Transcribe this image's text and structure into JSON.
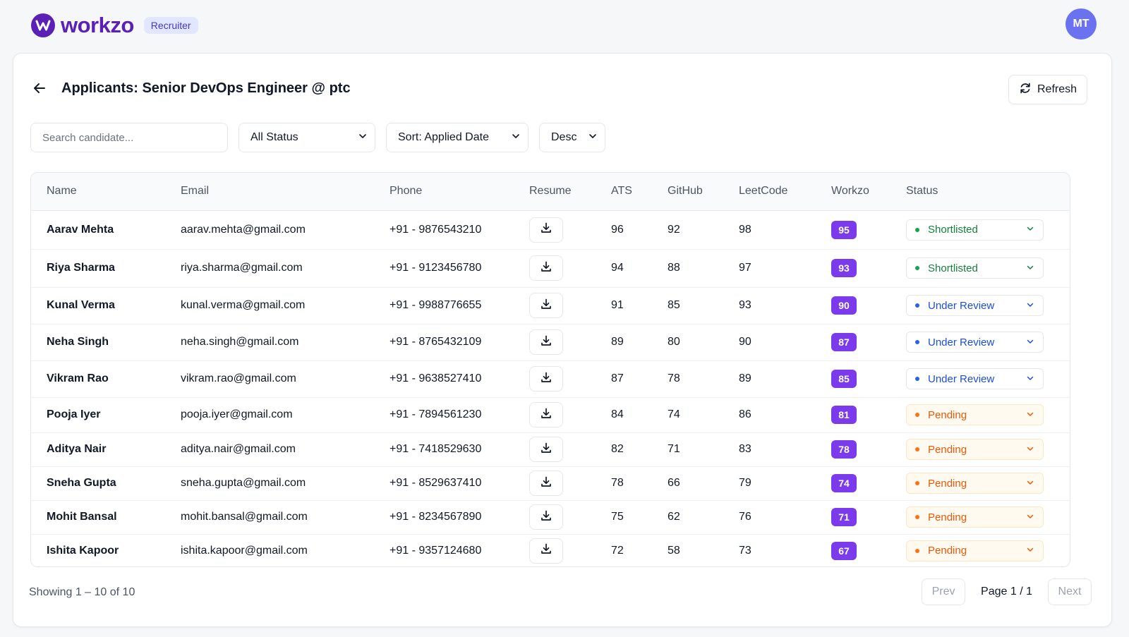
{
  "brand": {
    "name": "workzo",
    "role_badge": "Recruiter",
    "avatar_initials": "MT"
  },
  "header": {
    "title": "Applicants: Senior DevOps Engineer @ ptc",
    "refresh_label": "Refresh"
  },
  "filters": {
    "search_placeholder": "Search candidate...",
    "status_value": "All Status",
    "sort_value": "Sort: Applied Date",
    "order_value": "Desc"
  },
  "table": {
    "columns": [
      "Name",
      "Email",
      "Phone",
      "Resume",
      "ATS",
      "GitHub",
      "LeetCode",
      "Workzo",
      "Status"
    ],
    "rows": [
      {
        "name": "Aarav Mehta",
        "email": "aarav.mehta@gmail.com",
        "phone": "+91 - 9876543210",
        "ats": "96",
        "github": "92",
        "leetcode": "98",
        "workzo": "95",
        "status": "Shortlisted",
        "status_kind": "shortlisted"
      },
      {
        "name": "Riya Sharma",
        "email": "riya.sharma@gmail.com",
        "phone": "+91 - 9123456780",
        "ats": "94",
        "github": "88",
        "leetcode": "97",
        "workzo": "93",
        "status": "Shortlisted",
        "status_kind": "shortlisted"
      },
      {
        "name": "Kunal Verma",
        "email": "kunal.verma@gmail.com",
        "phone": "+91 - 9988776655",
        "ats": "91",
        "github": "85",
        "leetcode": "93",
        "workzo": "90",
        "status": "Under Review",
        "status_kind": "review"
      },
      {
        "name": "Neha Singh",
        "email": "neha.singh@gmail.com",
        "phone": "+91 - 8765432109",
        "ats": "89",
        "github": "80",
        "leetcode": "90",
        "workzo": "87",
        "status": "Under Review",
        "status_kind": "review"
      },
      {
        "name": "Vikram Rao",
        "email": "vikram.rao@gmail.com",
        "phone": "+91 - 9638527410",
        "ats": "87",
        "github": "78",
        "leetcode": "89",
        "workzo": "85",
        "status": "Under Review",
        "status_kind": "review"
      },
      {
        "name": "Pooja Iyer",
        "email": "pooja.iyer@gmail.com",
        "phone": "+91 - 7894561230",
        "ats": "84",
        "github": "74",
        "leetcode": "86",
        "workzo": "81",
        "status": "Pending",
        "status_kind": "pending"
      },
      {
        "name": "Aditya Nair",
        "email": "aditya.nair@gmail.com",
        "phone": "+91 - 7418529630",
        "ats": "82",
        "github": "71",
        "leetcode": "83",
        "workzo": "78",
        "status": "Pending",
        "status_kind": "pending"
      },
      {
        "name": "Sneha Gupta",
        "email": "sneha.gupta@gmail.com",
        "phone": "+91 - 8529637410",
        "ats": "78",
        "github": "66",
        "leetcode": "79",
        "workzo": "74",
        "status": "Pending",
        "status_kind": "pending"
      },
      {
        "name": "Mohit Bansal",
        "email": "mohit.bansal@gmail.com",
        "phone": "+91 - 8234567890",
        "ats": "75",
        "github": "62",
        "leetcode": "76",
        "workzo": "71",
        "status": "Pending",
        "status_kind": "pending"
      },
      {
        "name": "Ishita Kapoor",
        "email": "ishita.kapoor@gmail.com",
        "phone": "+91 - 9357124680",
        "ats": "72",
        "github": "58",
        "leetcode": "73",
        "workzo": "67",
        "status": "Pending",
        "status_kind": "pending"
      }
    ]
  },
  "status_styles": {
    "shortlisted": {
      "text": "#15803d",
      "dot": "#16a34a",
      "border": "#e5e7eb",
      "bg": "#ffffff"
    },
    "review": {
      "text": "#1d4ed8",
      "dot": "#2563eb",
      "border": "#e5e7eb",
      "bg": "#ffffff"
    },
    "pending": {
      "text": "#ea580c",
      "dot": "#f97316",
      "border": "#fde7c7",
      "bg": "#fffaf0"
    }
  },
  "footer": {
    "showing": "Showing 1 – 10 of 10",
    "prev_label": "Prev",
    "page_label": "Page 1 / 1",
    "next_label": "Next"
  },
  "colors": {
    "brand": "#5b21b6",
    "score_badge": "#7c3aed",
    "avatar": "#6b72f0"
  },
  "icons": [
    "workzo-logo-icon",
    "back-arrow-icon",
    "refresh-icon",
    "chevron-down-icon",
    "download-icon"
  ]
}
